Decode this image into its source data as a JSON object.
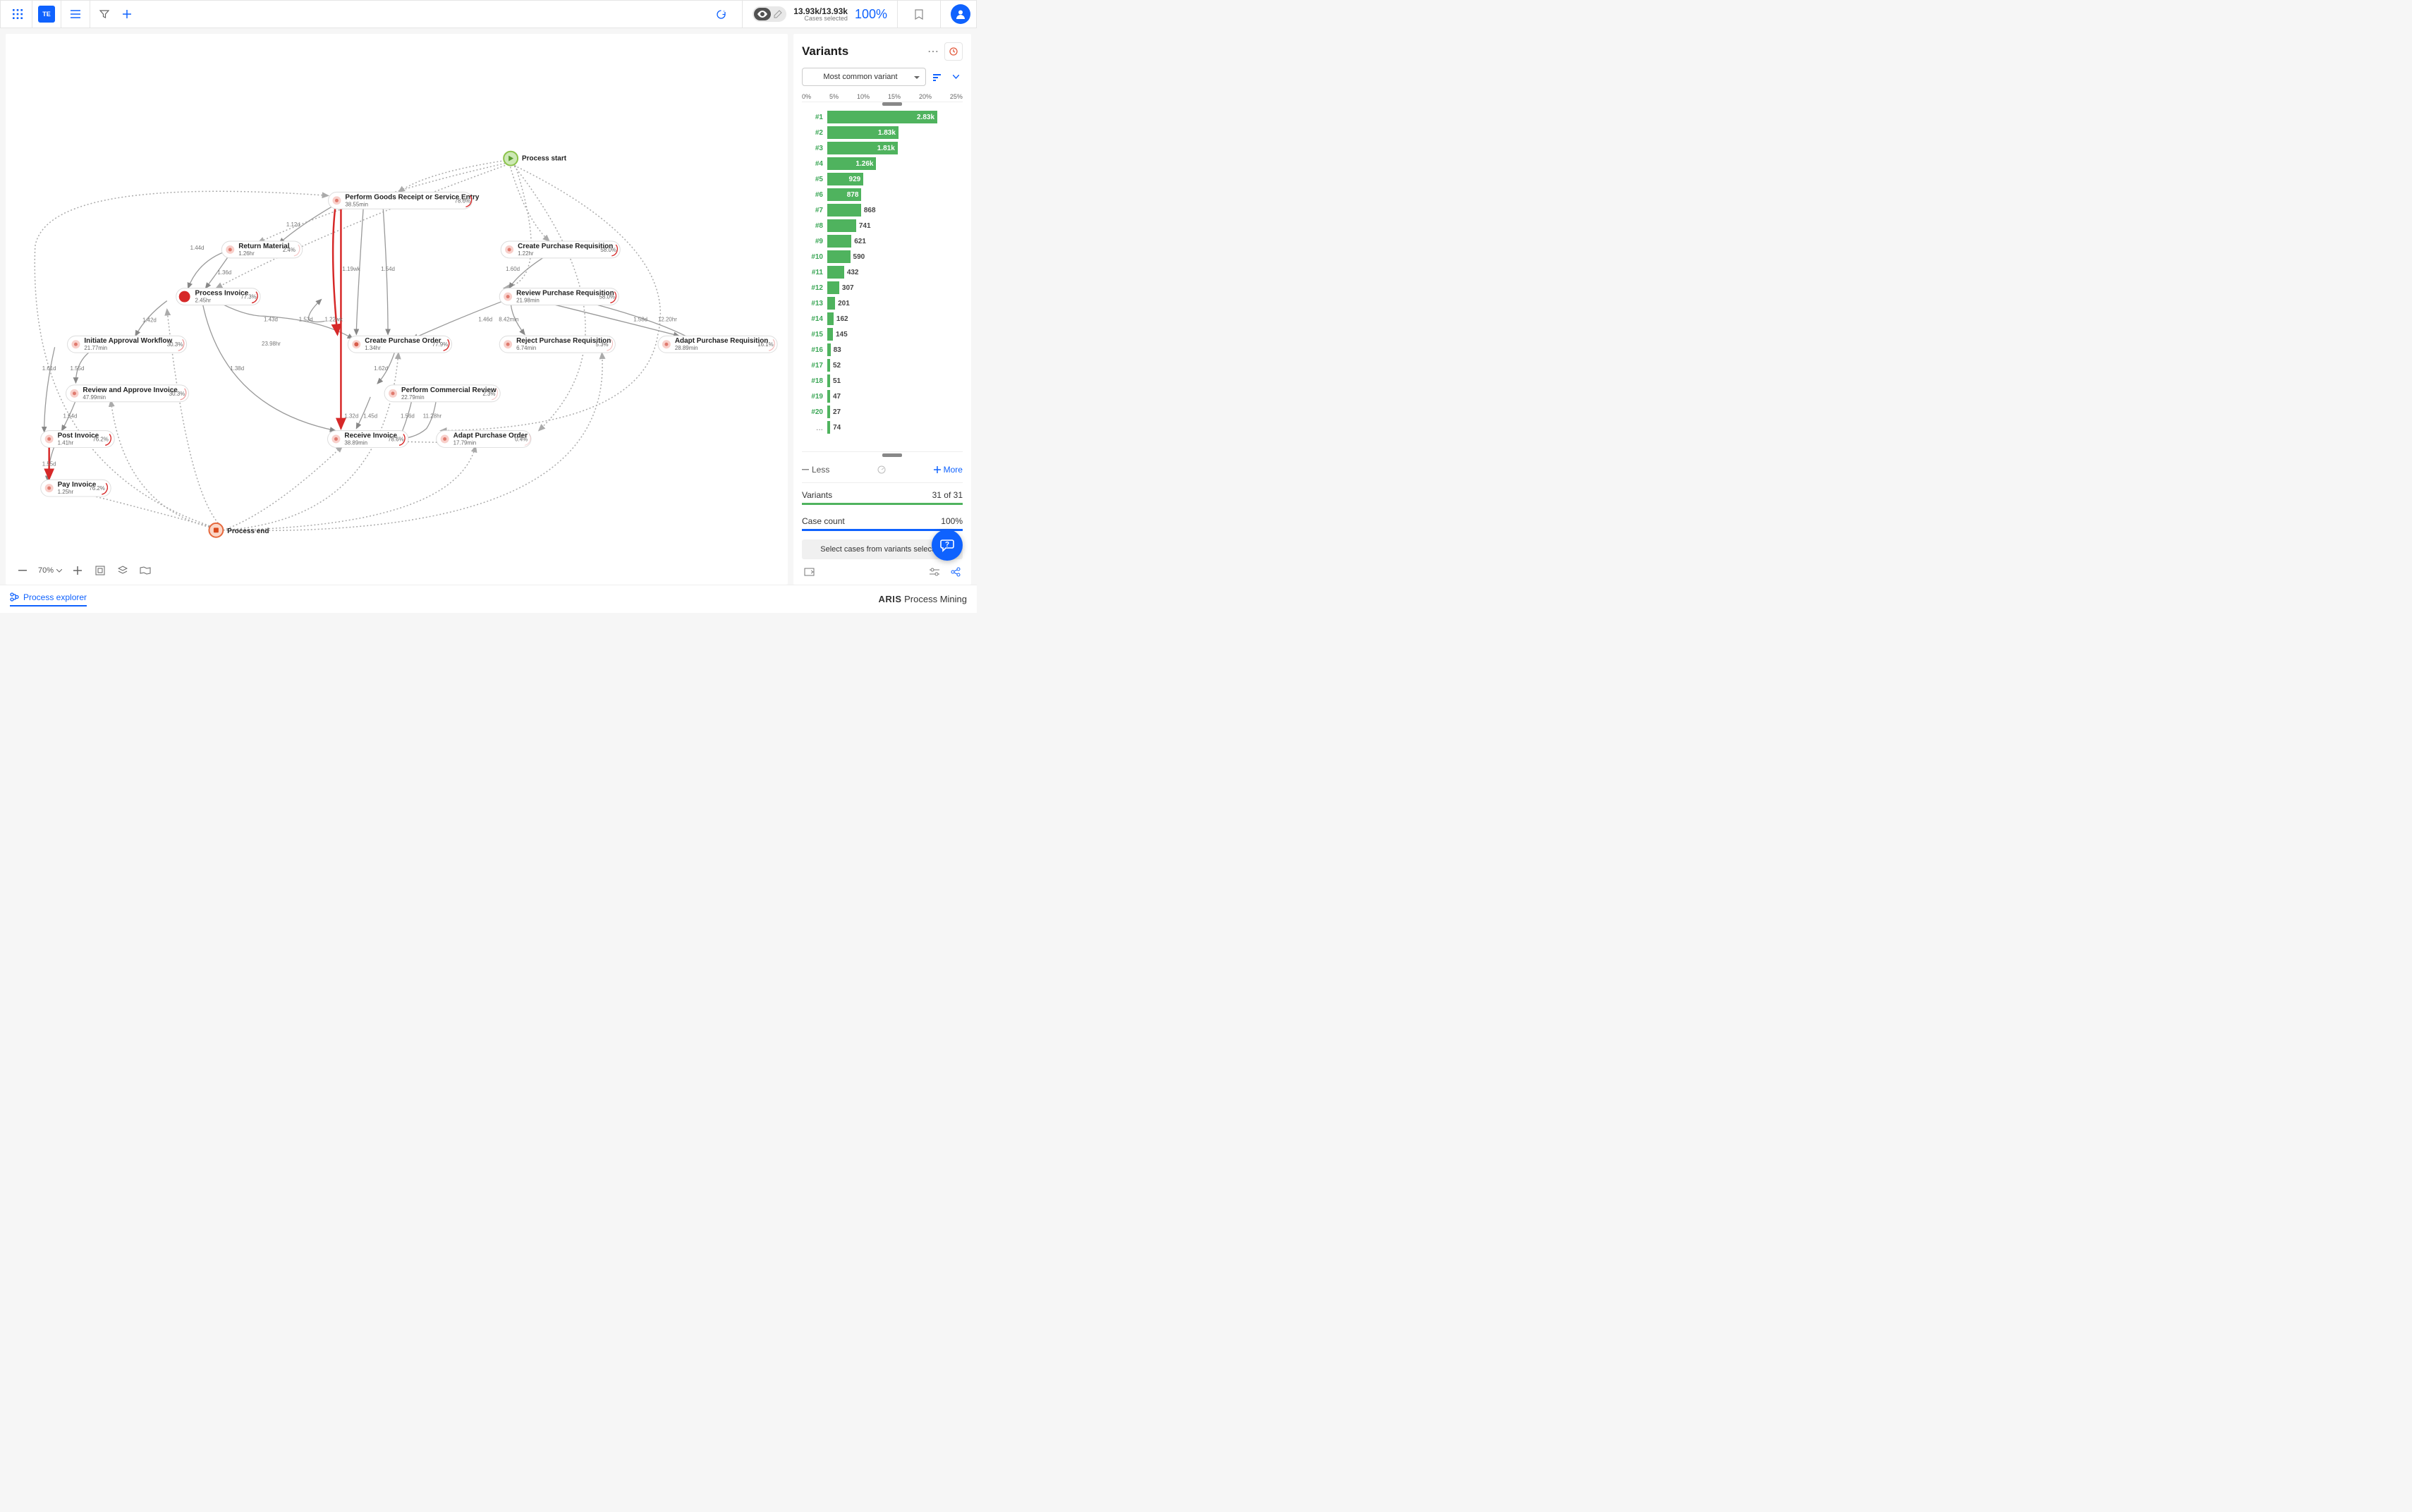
{
  "topbar": {
    "te_label": "TE",
    "cases_num": "13.93k/13.93k",
    "cases_label": "Cases selected",
    "percent": "100%"
  },
  "canvas": {
    "process_start": "Process start",
    "process_end": "Process end",
    "zoom": "70%",
    "nodes": {
      "goods": {
        "name": "Perform Goods Receipt or Service Entry",
        "sub": "38.55min",
        "pct": "78.6%"
      },
      "return_mat": {
        "name": "Return Material",
        "sub": "1.26hr",
        "pct": "2.4%"
      },
      "process_inv": {
        "name": "Process Invoice",
        "sub": "2.45hr",
        "pct": "77.3%"
      },
      "create_pr": {
        "name": "Create Purchase Requisition",
        "sub": "1.22hr",
        "pct": "58.0%"
      },
      "review_pr": {
        "name": "Review Purchase Requisition",
        "sub": "21.98min",
        "pct": "58.0%"
      },
      "initiate": {
        "name": "Initiate Approval Workflow",
        "sub": "21.77min",
        "pct": "30.3%"
      },
      "create_po": {
        "name": "Create Purchase Order",
        "sub": "1.34hr",
        "pct": "77.9%"
      },
      "reject_pr": {
        "name": "Reject Purchase Requisition",
        "sub": "6.74min",
        "pct": "5.3%"
      },
      "adapt_pr": {
        "name": "Adapt Purchase Requisition",
        "sub": "28.89min",
        "pct": "16.1%"
      },
      "review_inv": {
        "name": "Review and Approve Invoice",
        "sub": "47.99min",
        "pct": "30.3%"
      },
      "comm_rev": {
        "name": "Perform Commercial Review",
        "sub": "22.79min",
        "pct": "2.3%"
      },
      "receive_inv": {
        "name": "Receive Invoice",
        "sub": "38.89min",
        "pct": "78.6%"
      },
      "adapt_po": {
        "name": "Adapt Purchase Order",
        "sub": "17.79min",
        "pct": "0.4%"
      },
      "post_inv": {
        "name": "Post Invoice",
        "sub": "1.41hr",
        "pct": "76.2%"
      },
      "pay_inv": {
        "name": "Pay Invoice",
        "sub": "1.25hr",
        "pct": "76.2%"
      }
    },
    "edges": {
      "e1": "1.12d",
      "e2": "1.44d",
      "e3": "1.36d",
      "e4": "1.19wk",
      "e5": "1.54d",
      "e6": "1.60d",
      "e7": "1.42d",
      "e8": "1.43d",
      "e9": "1.53d",
      "e10": "1.22wk",
      "e11": "1.46d",
      "e12": "8.42min",
      "e13": "1.58d",
      "e14": "12.20hr",
      "e15": "23.98hr",
      "e16": "1.38d",
      "e17": "1.61d",
      "e18": "1.55d",
      "e19": "1.62d",
      "e20": "1.54d",
      "e21": "1.32d",
      "e22": "1.45d",
      "e23": "1.56d",
      "e24": "11.28hr",
      "e25": "1.55d"
    }
  },
  "panel": {
    "title": "Variants",
    "dropdown": "Most common variant",
    "axis": [
      "0%",
      "5%",
      "10%",
      "15%",
      "20%",
      "25%"
    ],
    "less": "Less",
    "more": "More",
    "variants_label": "Variants",
    "variants_val": "31 of 31",
    "case_label": "Case count",
    "case_val": "100%",
    "action": "Select cases from variants selection"
  },
  "chart_data": {
    "type": "bar",
    "title": "Variants",
    "xlabel": "",
    "ylabel": "",
    "xlim": [
      0,
      25
    ],
    "categories": [
      "#1",
      "#2",
      "#3",
      "#4",
      "#5",
      "#6",
      "#7",
      "#8",
      "#9",
      "#10",
      "#11",
      "#12",
      "#13",
      "#14",
      "#15",
      "#16",
      "#17",
      "#18",
      "#19",
      "#20",
      "..."
    ],
    "values_label": [
      "2.83k",
      "1.83k",
      "1.81k",
      "1.26k",
      "929",
      "878",
      "868",
      "741",
      "621",
      "590",
      "432",
      "307",
      "201",
      "162",
      "145",
      "83",
      "52",
      "51",
      "47",
      "27",
      "74"
    ],
    "values": [
      2830,
      1830,
      1810,
      1260,
      929,
      878,
      868,
      741,
      621,
      590,
      432,
      307,
      201,
      162,
      145,
      83,
      52,
      51,
      47,
      27,
      74
    ]
  },
  "bottombar": {
    "tab": "Process explorer",
    "brand_bold": "ARIS",
    "brand_light": "Process Mining"
  }
}
